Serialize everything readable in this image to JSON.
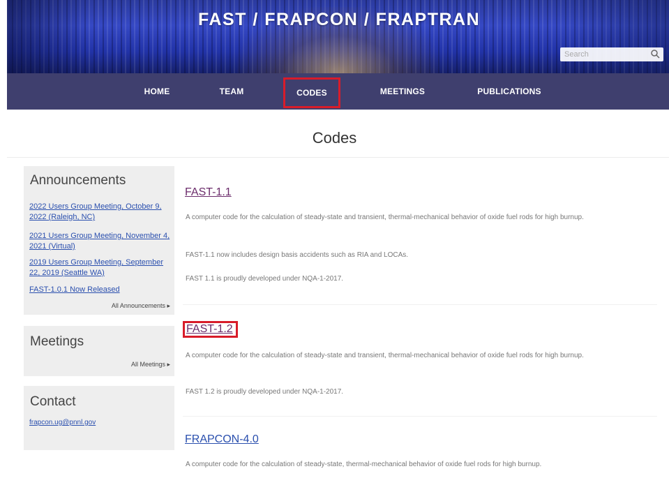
{
  "header": {
    "site_title": "FAST / FRAPCON / FRAPTRAN",
    "search_placeholder": "Search"
  },
  "nav": {
    "items": [
      {
        "label": "HOME"
      },
      {
        "label": "TEAM"
      },
      {
        "label": "CODES",
        "active": true
      },
      {
        "label": "MEETINGS"
      },
      {
        "label": "PUBLICATIONS"
      }
    ]
  },
  "page": {
    "title": "Codes"
  },
  "sidebar": {
    "announcements": {
      "title": "Announcements",
      "items": [
        {
          "label": "2022 Users Group Meeting, October 9, 2022 (Raleigh, NC)"
        },
        {
          "label": "2021 Users Group Meeting, November 4, 2021 (Virtual)"
        },
        {
          "label": "2019 Users Group Meeting, September 22, 2019 (Seattle WA)"
        },
        {
          "label": "FAST-1.0.1 Now Released"
        }
      ],
      "more_label": "All Announcements ▸"
    },
    "meetings": {
      "title": "Meetings",
      "more_label": "All Meetings ▸"
    },
    "contact": {
      "title": "Contact",
      "email": "frapcon.ug@pnnl.gov"
    }
  },
  "codes": [
    {
      "title": "FAST-1.1",
      "paragraphs": [
        "A computer code for the calculation of steady-state and transient, thermal-mechanical behavior of oxide fuel rods for high burnup.",
        "FAST-1.1 now includes design basis accidents such as RIA and LOCAs.",
        "FAST 1.1 is proudly developed under NQA-1-2017."
      ]
    },
    {
      "title": "FAST-1.2",
      "highlighted": true,
      "paragraphs": [
        "A computer code for the calculation of steady-state and transient, thermal-mechanical behavior of oxide fuel rods for high burnup.",
        "FAST 1.2 is proudly developed under NQA-1-2017."
      ]
    },
    {
      "title": "FRAPCON-4.0",
      "paragraphs": [
        "A computer code for the calculation of steady-state, thermal-mechanical behavior of oxide fuel rods for high burnup."
      ]
    }
  ],
  "colors": {
    "nav_bg": "#3f3f6e",
    "highlight_border": "#d81c2a",
    "link_blue": "#2a4fae",
    "visited_purple": "#6b2c6b",
    "sidebar_bg": "#eeeeee"
  }
}
